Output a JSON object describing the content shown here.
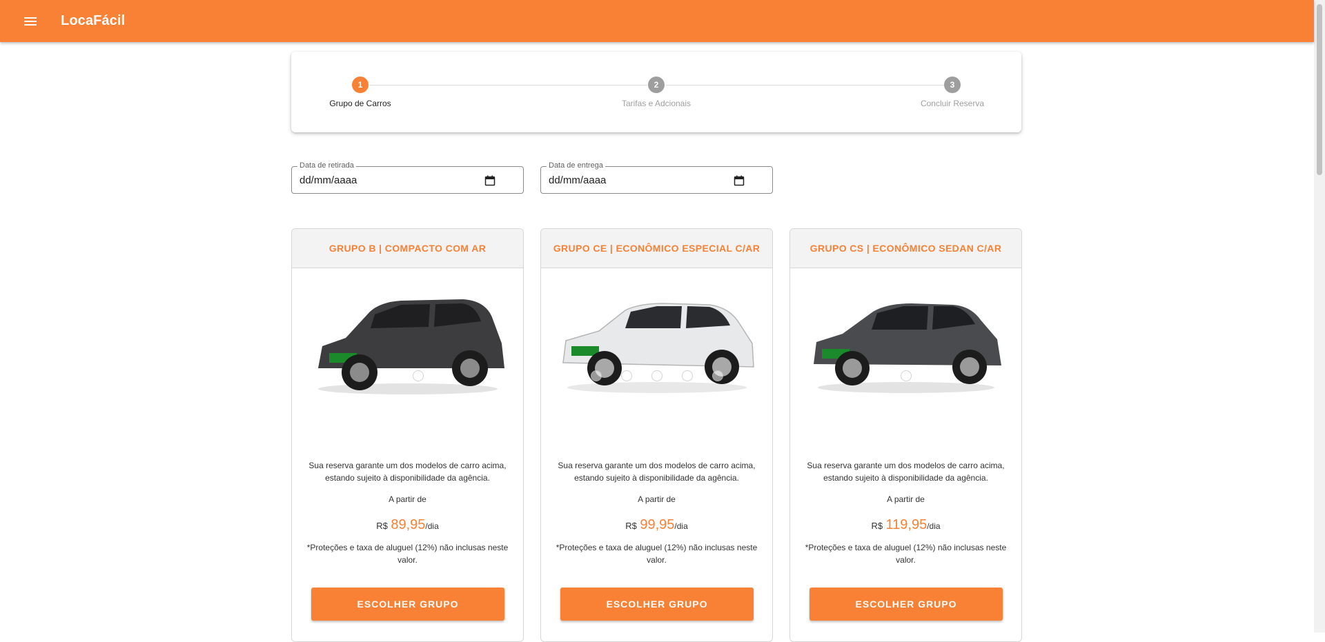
{
  "app": {
    "title": "LocaFácil"
  },
  "colors": {
    "accent": "#f88136",
    "inactive_step": "#9e9e9e"
  },
  "icons": {
    "menu": "menu-icon",
    "calendar": "calendar-icon"
  },
  "stepper": {
    "steps": [
      {
        "number": "1",
        "label": "Grupo de Carros",
        "state": "active"
      },
      {
        "number": "2",
        "label": "Tarifas e Adcionais",
        "state": "inactive"
      },
      {
        "number": "3",
        "label": "Concluir Reserva",
        "state": "inactive"
      }
    ]
  },
  "dates": {
    "pickup": {
      "label": "Data de retirada",
      "value": "dd/mm/aaaa"
    },
    "return": {
      "label": "Data de entrega",
      "value": "dd/mm/aaaa"
    }
  },
  "groups": [
    {
      "title": "GRUPO B | COMPACTO COM AR",
      "description": "Sua reserva garante um dos modelos de carro acima, estando sujeito à disponibilidade da agência.",
      "from_label": "A partir de",
      "currency": "R$",
      "price": "89,95",
      "unit": "/dia",
      "note": "*Proteções e taxa de aluguel (12%) não inclusas neste valor.",
      "button": "ESCOLHER GRUPO",
      "car_color": "#3d3d3f"
    },
    {
      "title": "GRUPO CE | ECONÔMICO ESPECIAL C/AR",
      "description": "Sua reserva garante um dos modelos de carro acima, estando sujeito à disponibilidade da agência.",
      "from_label": "A partir de",
      "currency": "R$",
      "price": "99,95",
      "unit": "/dia",
      "note": "*Proteções e taxa de aluguel (12%) não inclusas neste valor.",
      "button": "ESCOLHER GRUPO",
      "car_color": "#e8e9eb"
    },
    {
      "title": "GRUPO CS | ECONÔMICO SEDAN C/AR",
      "description": "Sua reserva garante um dos modelos de carro acima, estando sujeito à disponibilidade da agência.",
      "from_label": "A partir de",
      "currency": "R$",
      "price": "119,95",
      "unit": "/dia",
      "note": "*Proteções e taxa de aluguel (12%) não inclusas neste valor.",
      "button": "ESCOLHER GRUPO",
      "car_color": "#4a4b4e"
    }
  ]
}
